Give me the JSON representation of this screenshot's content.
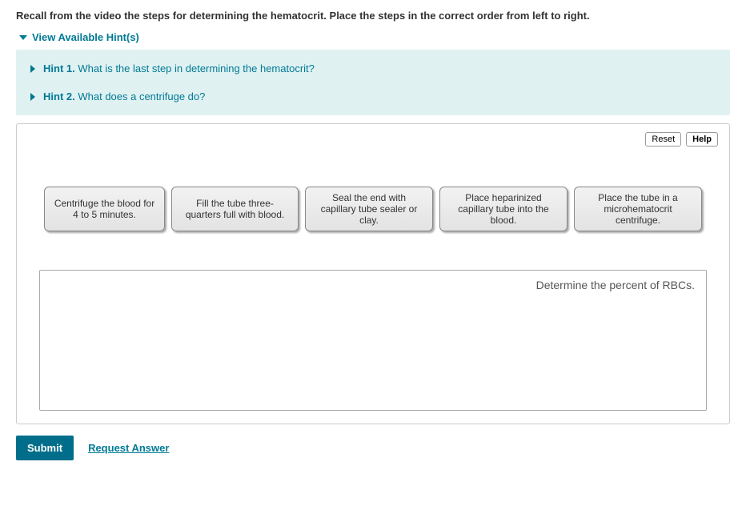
{
  "question": "Recall from the video the steps for determining the hematocrit. Place the steps in the correct order from left to right.",
  "hints_toggle": "View Available Hint(s)",
  "hints": [
    {
      "number": "Hint 1.",
      "text": "What is the last step in determining the hematocrit?"
    },
    {
      "number": "Hint 2.",
      "text": "What does a centrifuge do?"
    }
  ],
  "toolbar": {
    "reset": "Reset",
    "help": "Help"
  },
  "tiles": [
    "Centrifuge the blood for 4 to 5 minutes.",
    "Fill the tube three-quarters full with blood.",
    "Seal the end with capillary tube sealer or clay.",
    "Place heparinized capillary tube into the blood.",
    "Place the tube in a microhematocrit centrifuge."
  ],
  "dropzone_placeholder": "Determine the percent of RBCs.",
  "footer": {
    "submit": "Submit",
    "request": "Request Answer"
  }
}
